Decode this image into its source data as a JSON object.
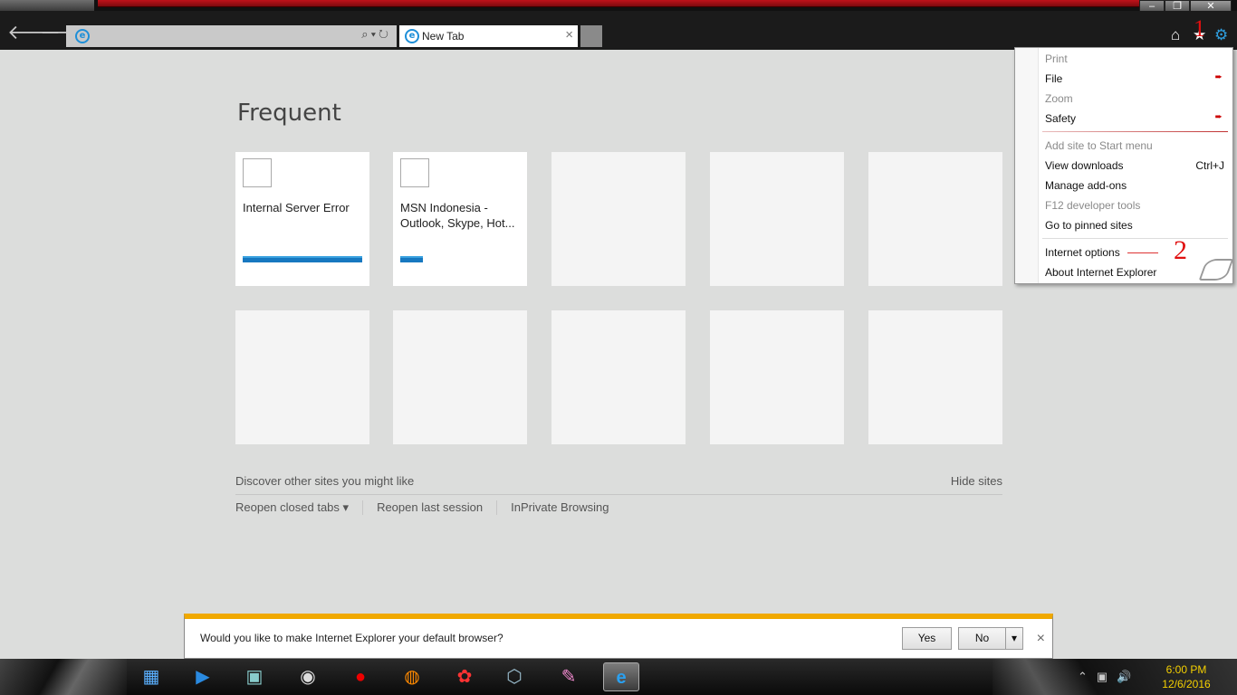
{
  "window": {
    "minimize_glyph": "–",
    "restore_glyph": "❐",
    "close_glyph": "✕"
  },
  "nav": {
    "back_glyph": "🡐",
    "forward_glyph": "🡒",
    "address_value": "",
    "address_tools": "⌕▾↻"
  },
  "tab": {
    "title": "New Tab",
    "close_glyph": "×"
  },
  "commands": {
    "home_glyph": "⌂",
    "favorites_glyph": "★",
    "tools_glyph": "⚙"
  },
  "annotations": {
    "one": "1",
    "two": "2"
  },
  "newtab_page": {
    "heading": "Frequent",
    "tiles": [
      {
        "title": "Internal Server Error",
        "bar_fraction": 1.0
      },
      {
        "title": "MSN Indonesia - Outlook, Skype, Hot...",
        "bar_fraction": 0.19
      }
    ],
    "discover_text": "Discover other sites you might like",
    "hide_sites": "Hide sites",
    "reopen_closed_tabs": "Reopen closed tabs ▾",
    "reopen_last_session": "Reopen last session",
    "inprivate": "InPrivate Browsing"
  },
  "tools_menu": {
    "print": "Print",
    "file": "File",
    "zoom": "Zoom",
    "safety": "Safety",
    "add_site": "Add site to Start menu",
    "view_downloads": "View downloads",
    "view_downloads_shortcut": "Ctrl+J",
    "manage_addons": "Manage add-ons",
    "f12": "F12 developer tools",
    "pinned": "Go to pinned sites",
    "internet_options": "Internet options",
    "about": "About Internet Explorer",
    "submenu_arrow": "➨"
  },
  "notification": {
    "message": "Would you like to make Internet Explorer your default browser?",
    "yes": "Yes",
    "no": "No",
    "dropdown_glyph": "▾",
    "close_glyph": "×"
  },
  "taskbar": {
    "tray_icons": "⌃▣🔊",
    "time": "6:00 PM",
    "date": "12/6/2016"
  }
}
